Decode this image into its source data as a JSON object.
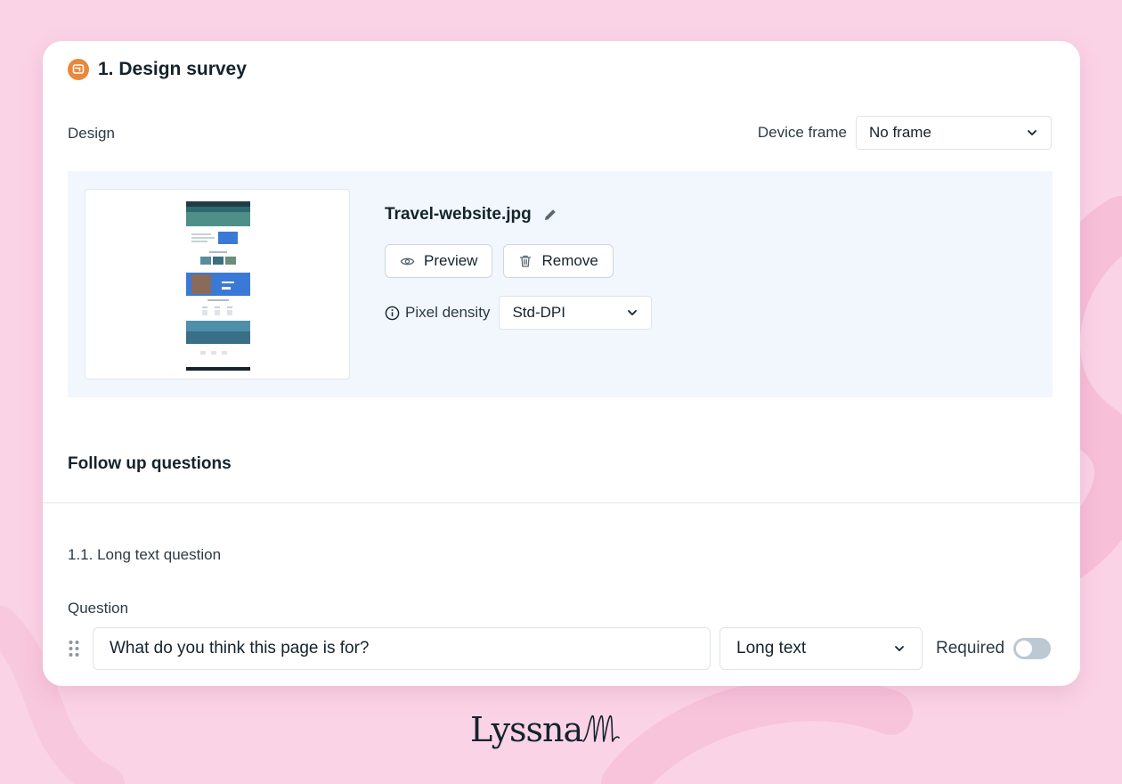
{
  "card": {
    "title": "1. Design survey",
    "design_label": "Design",
    "device_frame_label": "Device frame",
    "device_frame_value": "No frame",
    "file_name": "Travel-website.jpg",
    "preview_label": "Preview",
    "remove_label": "Remove",
    "pixel_density_label": "Pixel density",
    "pixel_density_value": "Std-DPI",
    "follow_up_title": "Follow up questions",
    "question_heading": "1.1. Long text question",
    "question_label": "Question",
    "question_value": "What do you think this page is for?",
    "question_type": "Long text",
    "required_label": "Required",
    "required_on": false
  },
  "brand": {
    "logo_text": "Lyssna"
  },
  "colors": {
    "background": "#fbd3e6",
    "accent_orange": "#e8883a",
    "panel": "#f1f7fc",
    "toggle_off": "#bcc8d4"
  },
  "icons": [
    "survey-icon",
    "pencil-icon",
    "eye-icon",
    "trash-icon",
    "info-icon",
    "chevron-down-icon",
    "drag-handle-icon"
  ]
}
